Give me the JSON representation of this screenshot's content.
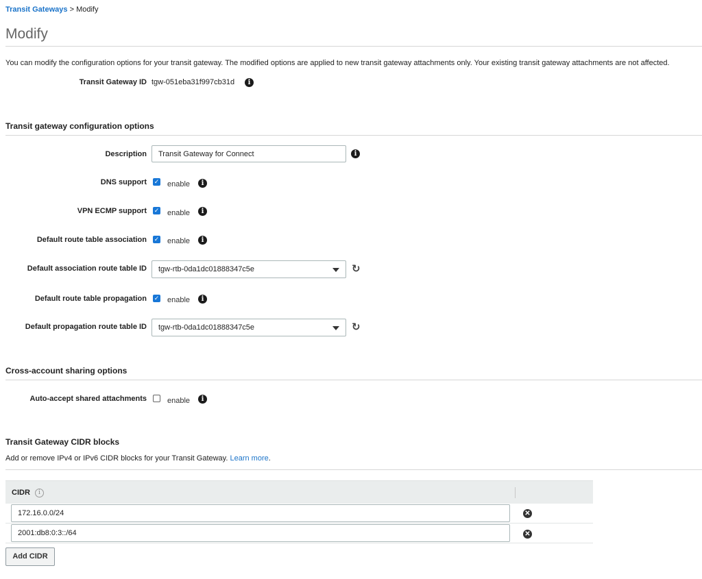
{
  "breadcrumb": {
    "parent": "Transit Gateways",
    "separator": ">",
    "current": "Modify"
  },
  "page_title": "Modify",
  "intro": "You can modify the configuration options for your transit gateway. The modified options are applied to new transit gateway attachments only. Your existing transit gateway attachments are not affected.",
  "tgw": {
    "label": "Transit Gateway ID",
    "value": "tgw-051eba31f997cb31d"
  },
  "config": {
    "title": "Transit gateway configuration options",
    "description": {
      "label": "Description",
      "value": "Transit Gateway for Connect"
    },
    "dns": {
      "label": "DNS support",
      "checked": true,
      "text": "enable"
    },
    "vpn": {
      "label": "VPN ECMP support",
      "checked": true,
      "text": "enable"
    },
    "assoc": {
      "label": "Default route table association",
      "checked": true,
      "text": "enable"
    },
    "assoc_id": {
      "label": "Default association route table ID",
      "value": "tgw-rtb-0da1dc01888347c5e"
    },
    "prop": {
      "label": "Default route table propagation",
      "checked": true,
      "text": "enable"
    },
    "prop_id": {
      "label": "Default propagation route table ID",
      "value": "tgw-rtb-0da1dc01888347c5e"
    }
  },
  "sharing": {
    "title": "Cross-account sharing options",
    "auto_accept": {
      "label": "Auto-accept shared attachments",
      "checked": false,
      "text": "enable"
    }
  },
  "cidr": {
    "title": "Transit Gateway CIDR blocks",
    "desc": "Add or remove IPv4 or IPv6 CIDR blocks for your Transit Gateway.",
    "learn_more": "Learn more",
    "period": ".",
    "column": "CIDR",
    "rows": [
      "172.16.0.0/24",
      "2001:db8:0:3::/64"
    ],
    "add_label": "Add CIDR"
  },
  "icons": {
    "info": "info-icon",
    "refresh": "refresh-icon",
    "remove": "remove-icon",
    "dropdown": "chevron-down-icon",
    "check": "checkmark-icon"
  },
  "colors": {
    "link": "#1a73c9",
    "checkbox": "#1877d7",
    "table_header": "#eaeded"
  }
}
